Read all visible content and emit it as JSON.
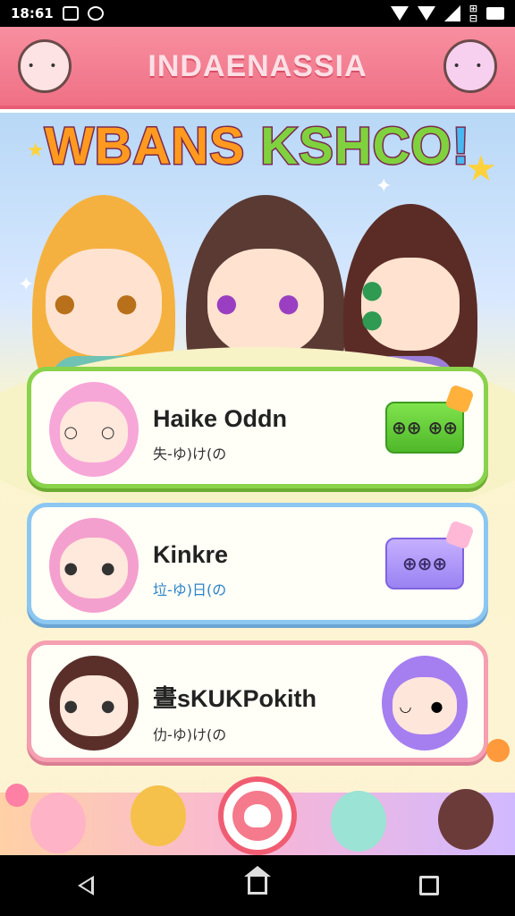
{
  "status_bar": {
    "time": "18:61"
  },
  "header": {
    "title": "INDAENASSIA"
  },
  "banner": {
    "parts": [
      "WBANS ",
      "KSHCO",
      "!"
    ]
  },
  "cards": [
    {
      "name": "Haike Oddn",
      "subtitle": "失-ゆ)け(の",
      "button": "⊕⊕ ⊕⊕"
    },
    {
      "name": "Kinkre",
      "subtitle": "垃-ゆ)日(の",
      "button": "⊕⊕⊕"
    },
    {
      "name": "晝sKUKPokith",
      "subtitle": "仂-ゆ)け(の"
    }
  ],
  "colors": {
    "header": "#f07085",
    "card1_border": "#8ad24b",
    "card2_border": "#8cc7f2",
    "card3_border": "#f59fb1",
    "accent": "#f05d72"
  }
}
